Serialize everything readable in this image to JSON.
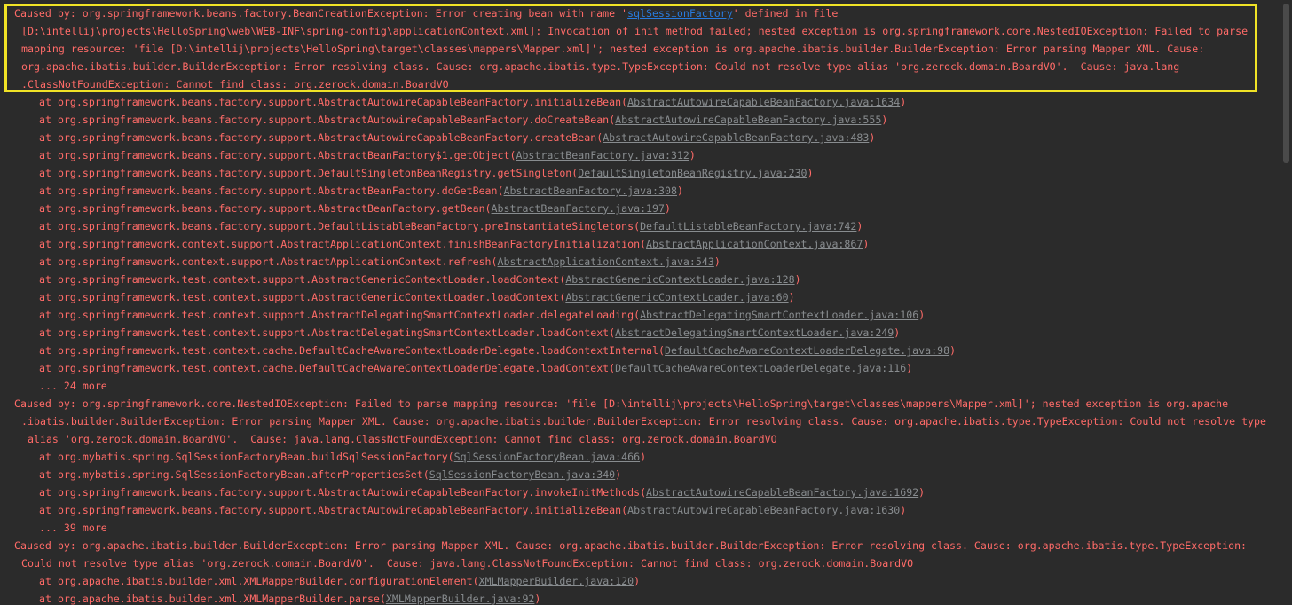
{
  "colors": {
    "background": "#2b2b2b",
    "error_text": "#ff6b68",
    "link_gray": "#888c8f",
    "link_blue": "#287bde",
    "highlight_border": "#f0e226"
  },
  "console": {
    "l01": {
      "pre": "Caused by: org.springframework.beans.factory.BeanCreationException: Error creating bean with name '",
      "link": "sqlSessionFactory",
      "post": "' defined in file"
    },
    "l02": "[D:\\intellij\\projects\\HelloSpring\\web\\WEB-INF\\spring-config\\applicationContext.xml]: Invocation of init method failed; nested exception is org.springframework.core.NestedIOException: Failed to parse",
    "l03": "mapping resource: 'file [D:\\intellij\\projects\\HelloSpring\\target\\classes\\mappers\\Mapper.xml]'; nested exception is org.apache.ibatis.builder.BuilderException: Error parsing Mapper XML. Cause:",
    "l04": "org.apache.ibatis.builder.BuilderException: Error resolving class. Cause: org.apache.ibatis.type.TypeException: Could not resolve type alias 'org.zerock.domain.BoardVO'.  Cause: java.lang",
    "l05": ".ClassNotFoundException: Cannot find class: org.zerock.domain.BoardVO",
    "l06": {
      "pre": "at org.springframework.beans.factory.support.AbstractAutowireCapableBeanFactory.initializeBean(",
      "link": "AbstractAutowireCapableBeanFactory.java:1634",
      "post": ")"
    },
    "l07": {
      "pre": "at org.springframework.beans.factory.support.AbstractAutowireCapableBeanFactory.doCreateBean(",
      "link": "AbstractAutowireCapableBeanFactory.java:555",
      "post": ")"
    },
    "l08": {
      "pre": "at org.springframework.beans.factory.support.AbstractAutowireCapableBeanFactory.createBean(",
      "link": "AbstractAutowireCapableBeanFactory.java:483",
      "post": ")"
    },
    "l09": {
      "pre": "at org.springframework.beans.factory.support.AbstractBeanFactory$1.getObject(",
      "link": "AbstractBeanFactory.java:312",
      "post": ")"
    },
    "l10": {
      "pre": "at org.springframework.beans.factory.support.DefaultSingletonBeanRegistry.getSingleton(",
      "link": "DefaultSingletonBeanRegistry.java:230",
      "post": ")"
    },
    "l11": {
      "pre": "at org.springframework.beans.factory.support.AbstractBeanFactory.doGetBean(",
      "link": "AbstractBeanFactory.java:308",
      "post": ")"
    },
    "l12": {
      "pre": "at org.springframework.beans.factory.support.AbstractBeanFactory.getBean(",
      "link": "AbstractBeanFactory.java:197",
      "post": ")"
    },
    "l13": {
      "pre": "at org.springframework.beans.factory.support.DefaultListableBeanFactory.preInstantiateSingletons(",
      "link": "DefaultListableBeanFactory.java:742",
      "post": ")"
    },
    "l14": {
      "pre": "at org.springframework.context.support.AbstractApplicationContext.finishBeanFactoryInitialization(",
      "link": "AbstractApplicationContext.java:867",
      "post": ")"
    },
    "l15": {
      "pre": "at org.springframework.context.support.AbstractApplicationContext.refresh(",
      "link": "AbstractApplicationContext.java:543",
      "post": ")"
    },
    "l16": {
      "pre": "at org.springframework.test.context.support.AbstractGenericContextLoader.loadContext(",
      "link": "AbstractGenericContextLoader.java:128",
      "post": ")"
    },
    "l17": {
      "pre": "at org.springframework.test.context.support.AbstractGenericContextLoader.loadContext(",
      "link": "AbstractGenericContextLoader.java:60",
      "post": ")"
    },
    "l18": {
      "pre": "at org.springframework.test.context.support.AbstractDelegatingSmartContextLoader.delegateLoading(",
      "link": "AbstractDelegatingSmartContextLoader.java:106",
      "post": ")"
    },
    "l19": {
      "pre": "at org.springframework.test.context.support.AbstractDelegatingSmartContextLoader.loadContext(",
      "link": "AbstractDelegatingSmartContextLoader.java:249",
      "post": ")"
    },
    "l20": {
      "pre": "at org.springframework.test.context.cache.DefaultCacheAwareContextLoaderDelegate.loadContextInternal(",
      "link": "DefaultCacheAwareContextLoaderDelegate.java:98",
      "post": ")"
    },
    "l21": {
      "pre": "at org.springframework.test.context.cache.DefaultCacheAwareContextLoaderDelegate.loadContext(",
      "link": "DefaultCacheAwareContextLoaderDelegate.java:116",
      "post": ")"
    },
    "l22": "... 24 more",
    "l23": "Caused by: org.springframework.core.NestedIOException: Failed to parse mapping resource: 'file [D:\\intellij\\projects\\HelloSpring\\target\\classes\\mappers\\Mapper.xml]'; nested exception is org.apache",
    "l24": ".ibatis.builder.BuilderException: Error parsing Mapper XML. Cause: org.apache.ibatis.builder.BuilderException: Error resolving class. Cause: org.apache.ibatis.type.TypeException: Could not resolve type",
    "l25": "alias 'org.zerock.domain.BoardVO'.  Cause: java.lang.ClassNotFoundException: Cannot find class: org.zerock.domain.BoardVO",
    "l26": {
      "pre": "at org.mybatis.spring.SqlSessionFactoryBean.buildSqlSessionFactory(",
      "link": "SqlSessionFactoryBean.java:466",
      "post": ")"
    },
    "l27": {
      "pre": "at org.mybatis.spring.SqlSessionFactoryBean.afterPropertiesSet(",
      "link": "SqlSessionFactoryBean.java:340",
      "post": ")"
    },
    "l28": {
      "pre": "at org.springframework.beans.factory.support.AbstractAutowireCapableBeanFactory.invokeInitMethods(",
      "link": "AbstractAutowireCapableBeanFactory.java:1692",
      "post": ")"
    },
    "l29": {
      "pre": "at org.springframework.beans.factory.support.AbstractAutowireCapableBeanFactory.initializeBean(",
      "link": "AbstractAutowireCapableBeanFactory.java:1630",
      "post": ")"
    },
    "l30": "... 39 more",
    "l31": "Caused by: org.apache.ibatis.builder.BuilderException: Error parsing Mapper XML. Cause: org.apache.ibatis.builder.BuilderException: Error resolving class. Cause: org.apache.ibatis.type.TypeException:",
    "l32": "Could not resolve type alias 'org.zerock.domain.BoardVO'.  Cause: java.lang.ClassNotFoundException: Cannot find class: org.zerock.domain.BoardVO",
    "l33": {
      "pre": "at org.apache.ibatis.builder.xml.XMLMapperBuilder.configurationElement(",
      "link": "XMLMapperBuilder.java:120",
      "post": ")"
    },
    "l34": {
      "pre": "at org.apache.ibatis.builder.xml.XMLMapperBuilder.parse(",
      "link": "XMLMapperBuilder.java:92",
      "post": ")"
    }
  }
}
